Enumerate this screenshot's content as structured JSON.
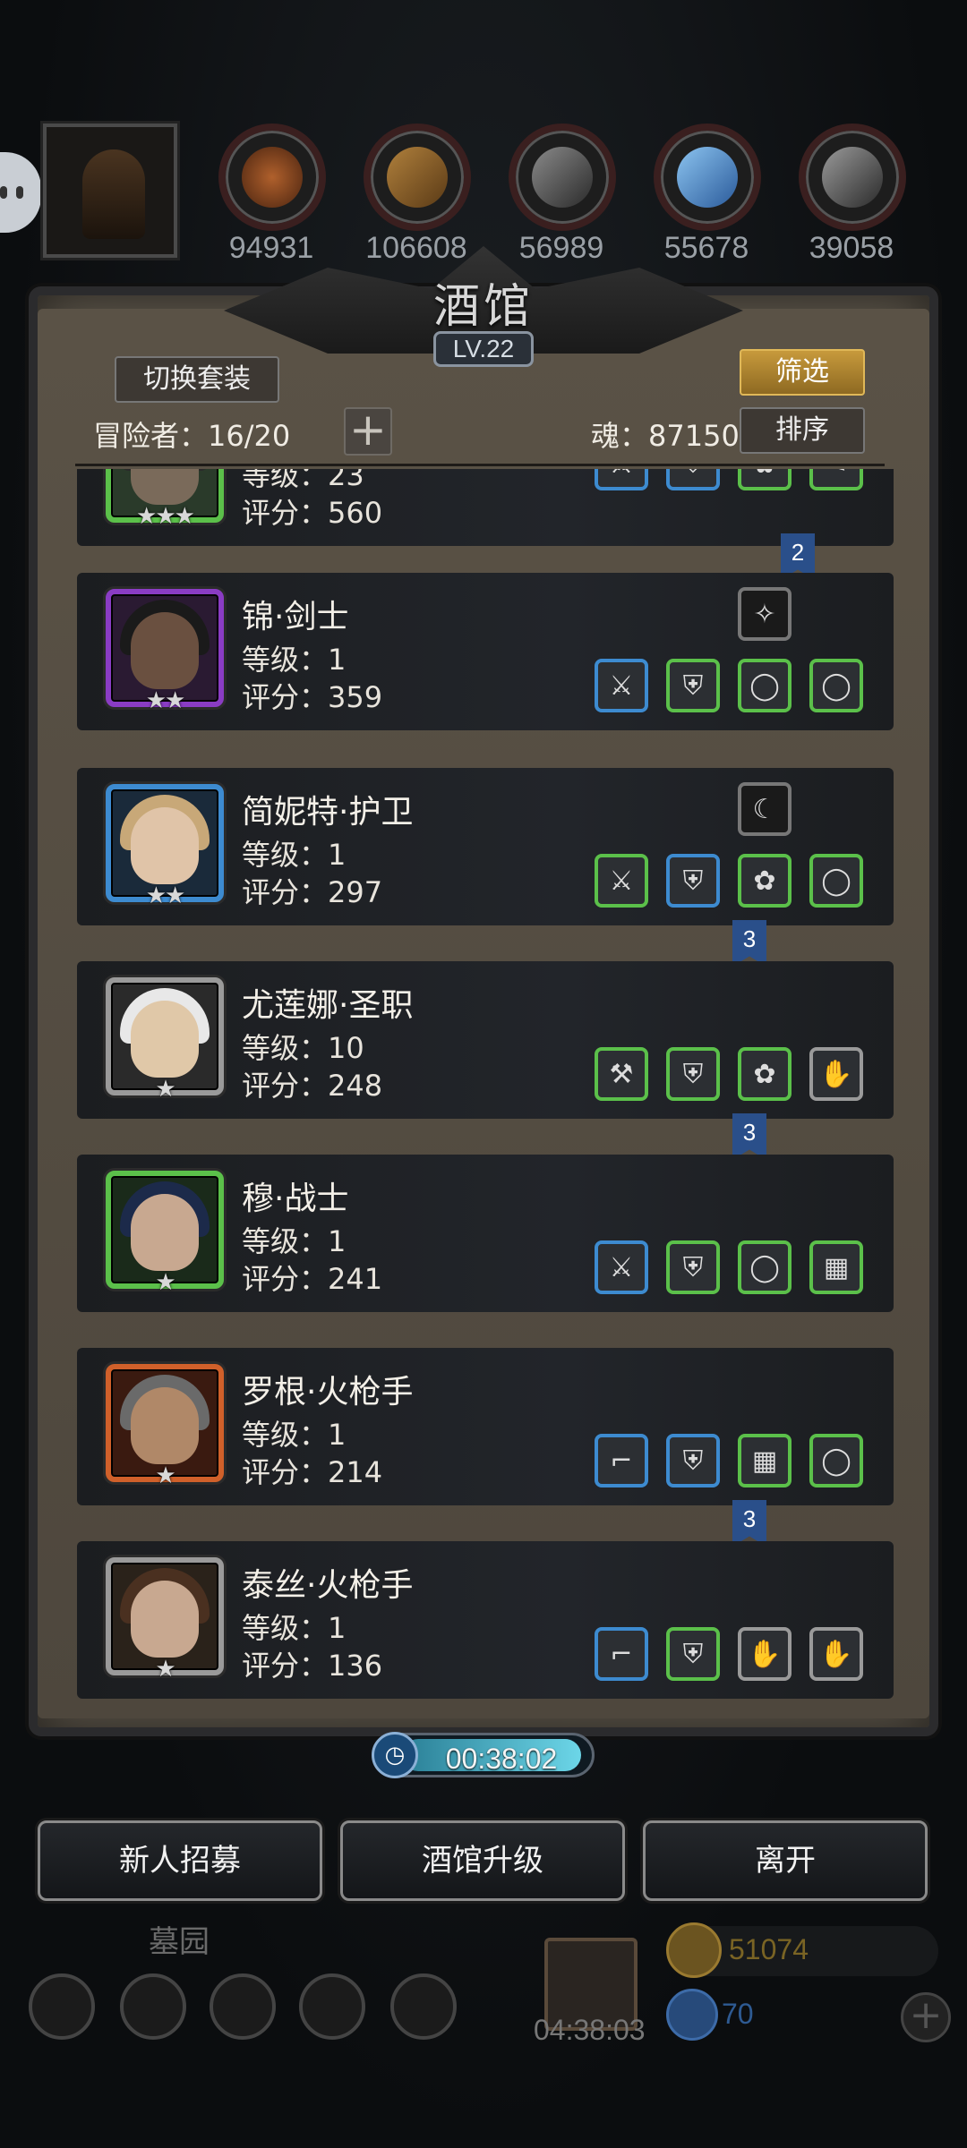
{
  "resources": [
    {
      "name": "meat-resource",
      "value": "94931",
      "color": "#8a4a24"
    },
    {
      "name": "wood-resource",
      "value": "106608",
      "color": "#8a6030"
    },
    {
      "name": "stone-resource",
      "value": "56989",
      "color": "#5e5e5e"
    },
    {
      "name": "crystal-resource",
      "value": "55678",
      "color": "#4a8ad0"
    },
    {
      "name": "iron-resource",
      "value": "39058",
      "color": "#6a6a6a"
    }
  ],
  "tavern": {
    "title": "酒馆",
    "level": "LV.22",
    "switch_outfit_label": "切换套装",
    "filter_label": "筛选",
    "sort_label": "排序",
    "adventurers_label": "冒险者：16/20",
    "soul_label": "魂：87150",
    "add_label": "+"
  },
  "heroes": [
    {
      "name": "",
      "level": "等级：23",
      "score": "评分：560",
      "stars": "★★★",
      "frame": "#5bc04a"
    },
    {
      "name": "锦·剑士",
      "level": "等级：1",
      "score": "评分：359",
      "stars": "★★",
      "frame": "#8a3cc4"
    },
    {
      "name": "简妮特·护卫",
      "level": "等级：1",
      "score": "评分：297",
      "stars": "★★",
      "frame": "#3d8bd0"
    },
    {
      "name": "尤莲娜·圣职",
      "level": "等级：10",
      "score": "评分：248",
      "stars": "★",
      "frame": "#9a9a9a"
    },
    {
      "name": "穆·战士",
      "level": "等级：1",
      "score": "评分：241",
      "stars": "★",
      "frame": "#5bc04a"
    },
    {
      "name": "罗根·火枪手",
      "level": "等级：1",
      "score": "评分：214",
      "stars": "★",
      "frame": "#d0602a"
    },
    {
      "name": "泰丝·火枪手",
      "level": "等级：1",
      "score": "评分：136",
      "stars": "★",
      "frame": "#9a9a9a"
    }
  ],
  "rank_flags": [
    "2",
    "3",
    "3",
    "3"
  ],
  "timer": {
    "value": "00:38:02",
    "icon": "clock-icon"
  },
  "bottom_buttons": {
    "recruit": "新人招募",
    "upgrade": "酒馆升级",
    "leave": "离开"
  },
  "footer": {
    "graveyard": "墓园",
    "gift_timer": "04:38:03",
    "gold": "51074",
    "gems": "70",
    "plus": "+"
  }
}
